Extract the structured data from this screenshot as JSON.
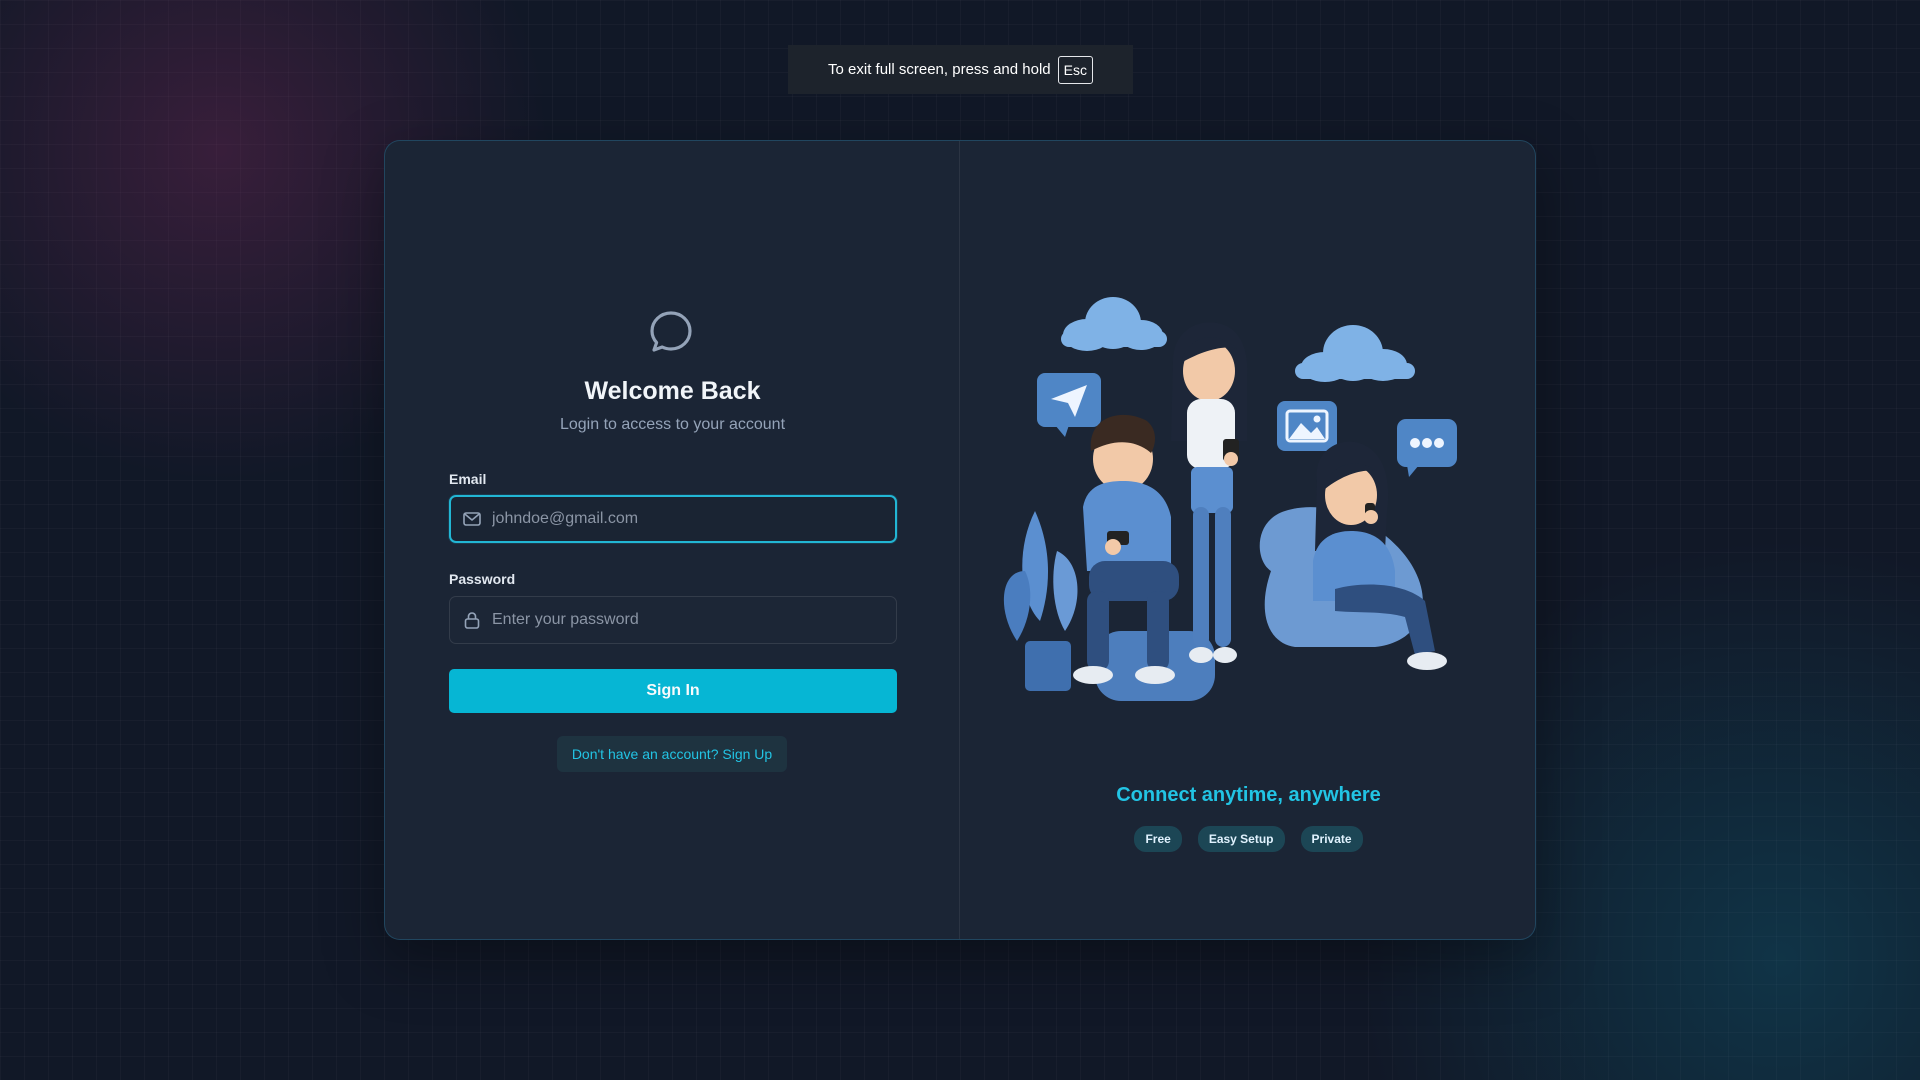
{
  "fullscreen_notice": {
    "text": "To exit full screen, press and hold",
    "key": "Esc"
  },
  "login": {
    "logo_icon": "chat-bubble-icon",
    "title": "Welcome Back",
    "subtitle": "Login to access to your account",
    "email": {
      "label": "Email",
      "value": "",
      "placeholder": "johndoe@gmail.com",
      "icon": "mail-icon"
    },
    "password": {
      "label": "Password",
      "value": "",
      "placeholder": "Enter your password",
      "icon": "lock-icon"
    },
    "sign_in_label": "Sign In",
    "sign_up_label": "Don't have an account? Sign Up"
  },
  "promo": {
    "illustration": "people-chatting-illustration",
    "tagline": "Connect anytime, anywhere",
    "badges": [
      "Free",
      "Easy Setup",
      "Private"
    ]
  },
  "colors": {
    "accent": "#06b6d4",
    "accent_text": "#22c4e4",
    "card_bg": "#1b2535",
    "page_bg": "#111827"
  }
}
